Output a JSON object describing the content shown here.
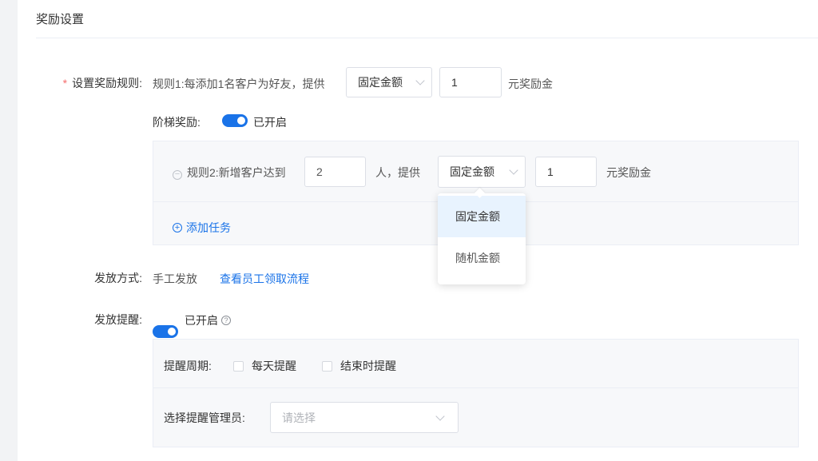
{
  "section": {
    "title": "奖励设置"
  },
  "reward_rule": {
    "required_mark": "*",
    "label": "设置奖励规则:",
    "rule1_text": "规则1:每添加1名客户为好友，提供",
    "rule1_type": "固定金额",
    "rule1_amount": "1",
    "rule1_suffix": "元奖励金"
  },
  "tier_reward": {
    "label": "阶梯奖励:",
    "status": "已开启",
    "enabled": true,
    "rule2_text": "规则2:新增客户达到",
    "rule2_count": "2",
    "rule2_mid": "人，提供",
    "rule2_type": "固定金额",
    "rule2_amount": "1",
    "rule2_suffix": "元奖励金",
    "add_task": "添加任务",
    "dropdown_options": [
      "固定金额",
      "随机金额"
    ]
  },
  "distribution": {
    "label": "发放方式:",
    "value": "手工发放",
    "link": "查看员工领取流程"
  },
  "reminder": {
    "label": "发放提醒:",
    "status": "已开启",
    "enabled": true,
    "period_label": "提醒周期:",
    "option_daily": "每天提醒",
    "option_end": "结束时提醒",
    "admin_label": "选择提醒管理员:",
    "admin_placeholder": "请选择"
  },
  "colors": {
    "accent": "#1a73e8",
    "required": "#f56c6c",
    "panel_bg": "#f7f8fa"
  }
}
